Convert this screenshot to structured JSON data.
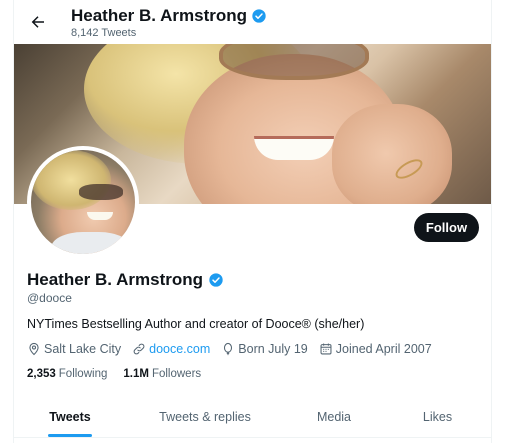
{
  "header": {
    "name": "Heather B. Armstrong",
    "tweet_count": "8,142 Tweets",
    "back_icon": "arrow-left-icon",
    "verified_icon": "verified-badge-icon"
  },
  "profile": {
    "name": "Heather B. Armstrong",
    "handle": "@dooce",
    "bio": "NYTimes Bestselling Author and creator of Dooce® (she/her)",
    "follow_label": "Follow",
    "location": "Salt Lake City",
    "website": "dooce.com",
    "birthday": "Born July 19",
    "joined": "Joined April 2007",
    "following_count": "2,353",
    "following_label": "Following",
    "followers_count": "1.1M",
    "followers_label": "Followers"
  },
  "tabs": [
    {
      "label": "Tweets",
      "active": true
    },
    {
      "label": "Tweets & replies",
      "active": false
    },
    {
      "label": "Media",
      "active": false
    },
    {
      "label": "Likes",
      "active": false
    }
  ],
  "colors": {
    "accent": "#1d9bf0",
    "text_primary": "#0f1419",
    "text_secondary": "#536471",
    "follow_button_bg": "#0f1419"
  }
}
